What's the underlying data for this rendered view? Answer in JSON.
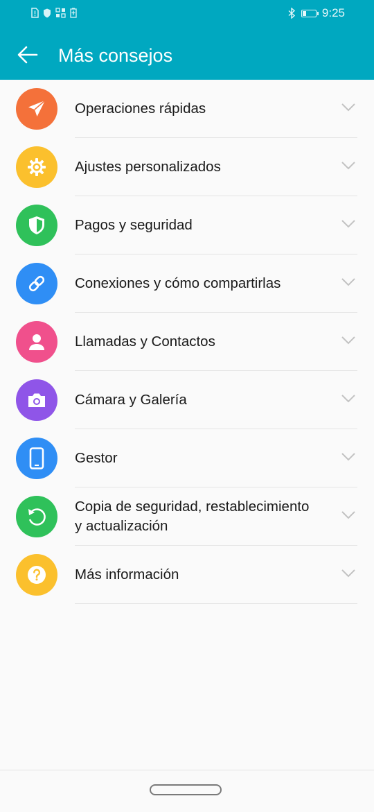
{
  "status_bar": {
    "time": "9:25",
    "icons": [
      "sim-alert-icon",
      "shield-icon",
      "apps-icon",
      "battery-saver-icon",
      "bluetooth-icon",
      "battery-icon"
    ]
  },
  "header": {
    "title": "Más consejos",
    "back_icon": "arrow-left-icon",
    "background_color": "#00a8c0"
  },
  "items": [
    {
      "label": "Operaciones rápidas",
      "icon": "paper-plane-icon",
      "color": "#f4713a"
    },
    {
      "label": "Ajustes personalizados",
      "icon": "gear-icon",
      "color": "#fbc02d"
    },
    {
      "label": "Pagos y seguridad",
      "icon": "shield-icon",
      "color": "#2fc15a"
    },
    {
      "label": "Conexiones y cómo compartirlas",
      "icon": "link-icon",
      "color": "#2f8ef5"
    },
    {
      "label": "Llamadas y Contactos",
      "icon": "person-icon",
      "color": "#f0508c"
    },
    {
      "label": "Cámara y Galería",
      "icon": "camera-icon",
      "color": "#8f55e8"
    },
    {
      "label": "Gestor",
      "icon": "phone-icon",
      "color": "#2f8ef5"
    },
    {
      "label": "Copia de seguridad, restablecimiento y actualización",
      "icon": "refresh-icon",
      "color": "#2fc15a"
    },
    {
      "label": "Más información",
      "icon": "question-icon",
      "color": "#fbc02d"
    }
  ],
  "expand_icon": "chevron-down-icon"
}
